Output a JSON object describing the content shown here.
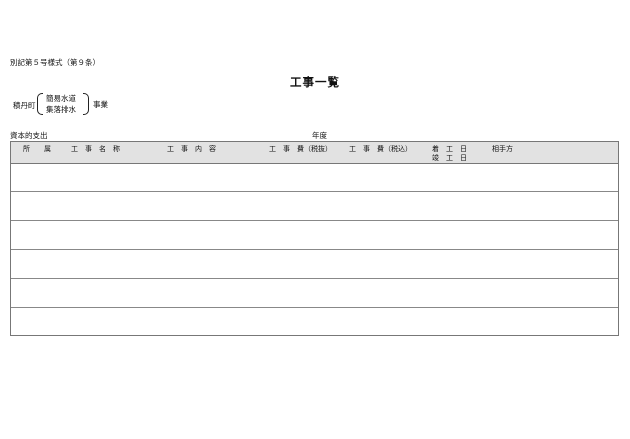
{
  "header": {
    "form_reference": "別記第５号様式（第９条）",
    "title": "工事一覧",
    "town": "積丹町",
    "project_options": [
      "簡易水道",
      "集落排水"
    ],
    "business_suffix": "事業",
    "capital_expenditure_label": "資本的支出",
    "fiscal_year_label": "年度"
  },
  "table": {
    "columns": {
      "affiliation": "所　　属",
      "project_name": "工　事　名　称",
      "project_content": "工　事　内　容",
      "cost_excl_tax": "工　事　費（税抜）",
      "cost_incl_tax": "工　事　費（税込）",
      "start": "着　工　日",
      "completion": "竣　工　日",
      "contractor": "相手方"
    },
    "rows": [
      {},
      {},
      {},
      {},
      {},
      {}
    ]
  }
}
